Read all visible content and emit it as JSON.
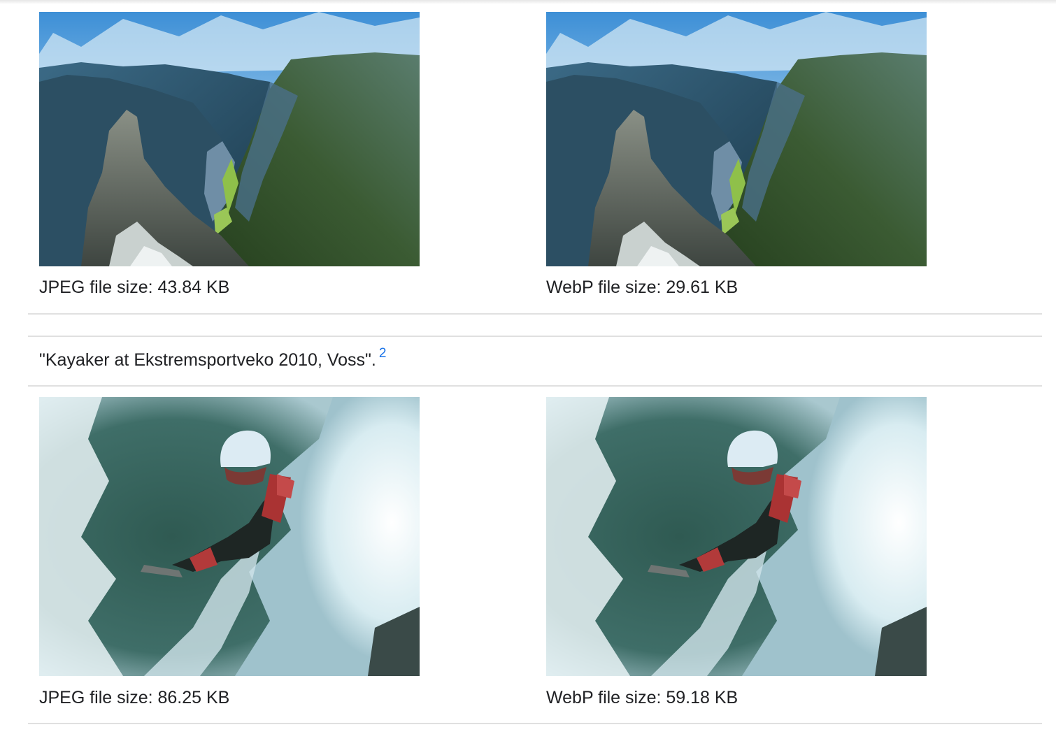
{
  "comparisons": [
    {
      "jpeg_caption": "JPEG file size: 43.84 KB",
      "webp_caption": "WebP file size: 29.61 KB",
      "jpeg_image": "fjord-valley-photo",
      "webp_image": "fjord-valley-photo"
    },
    {
      "jpeg_caption": "JPEG file size: 86.25 KB",
      "webp_caption": "WebP file size: 59.18 KB",
      "jpeg_image": "kayaker-waterfall-photo",
      "webp_image": "kayaker-waterfall-photo"
    }
  ],
  "credit": {
    "text": "\"Kayaker at Ekstremsportveko 2010, Voss\".",
    "footnote": "2"
  },
  "colors": {
    "link": "#1a73e8",
    "divider": "#e0e0e0",
    "text": "#202124"
  }
}
